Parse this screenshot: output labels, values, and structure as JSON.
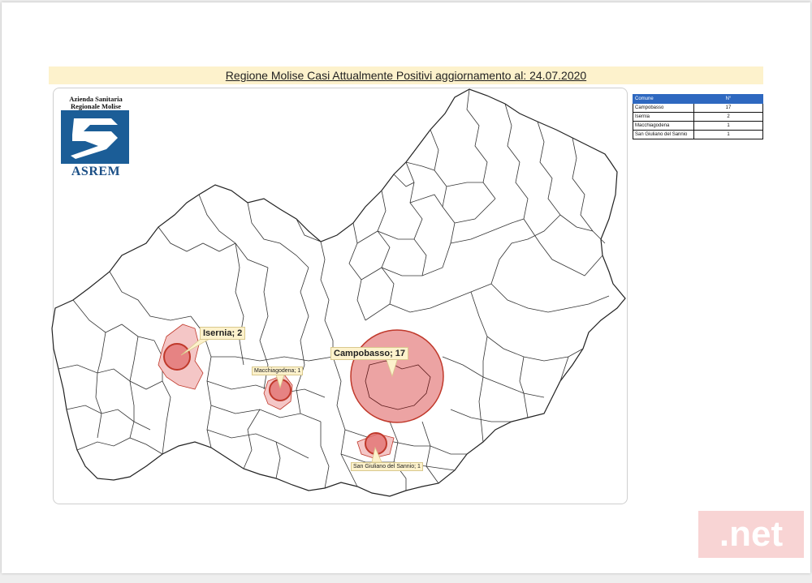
{
  "title": "Regione Molise Casi Attualmente Positivi aggiornamento al: 24.07.2020",
  "logo": {
    "line1": "Azienda Sanitaria",
    "line2": "Regionale Molise",
    "brand": "ASREM",
    "color": "#1b5d97"
  },
  "table": {
    "headers": [
      "Comune",
      "N°"
    ],
    "rows": [
      {
        "comune": "Campobasso",
        "n": "17"
      },
      {
        "comune": "Isernia",
        "n": "2"
      },
      {
        "comune": "Macchiagodena",
        "n": "1"
      },
      {
        "comune": "San Giuliano del Sannio",
        "n": "1"
      }
    ]
  },
  "markers": {
    "campobasso": "Campobasso; 17",
    "isernia": "Isernia; 2",
    "macchiagodena": "Macchiagodena; 1",
    "san_giuliano": "San Giuliano del Sannio; 1"
  },
  "colors": {
    "bubble_fill": "#e06666",
    "bubble_stroke": "#c0392b",
    "highlight_fill": "#f4c6c6",
    "label_bg": "#fdf2cc",
    "header_bg": "#2e68c0"
  },
  "watermark": ".net"
}
